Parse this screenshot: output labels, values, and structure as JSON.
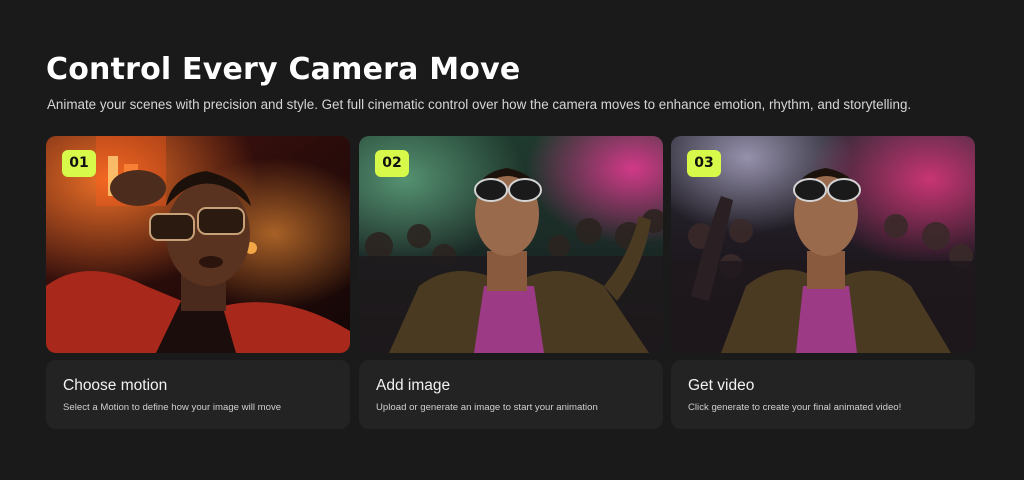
{
  "header": {
    "title": "Control Every Camera Move",
    "subtitle": "Animate your scenes with precision and style. Get full cinematic control over how the camera moves to enhance emotion, rhythm, and storytelling."
  },
  "steps": [
    {
      "number": "01",
      "title": "Choose motion",
      "description": "Select a Motion to define how your image will move",
      "image": "man-in-red-suit-with-sunglasses-photo"
    },
    {
      "number": "02",
      "title": "Add image",
      "description": "Upload or generate an image to start your animation",
      "image": "man-with-sunglasses-in-crowded-club-photo"
    },
    {
      "number": "03",
      "title": "Get video",
      "description": "Click generate to create your final animated video!",
      "image": "man-with-sunglasses-in-crowded-club-photo"
    }
  ],
  "colors": {
    "background": "#1a1a1a",
    "card": "#232323",
    "badge": "#d7f94a",
    "title": "#ffffff",
    "text": "#d6d6d6"
  }
}
